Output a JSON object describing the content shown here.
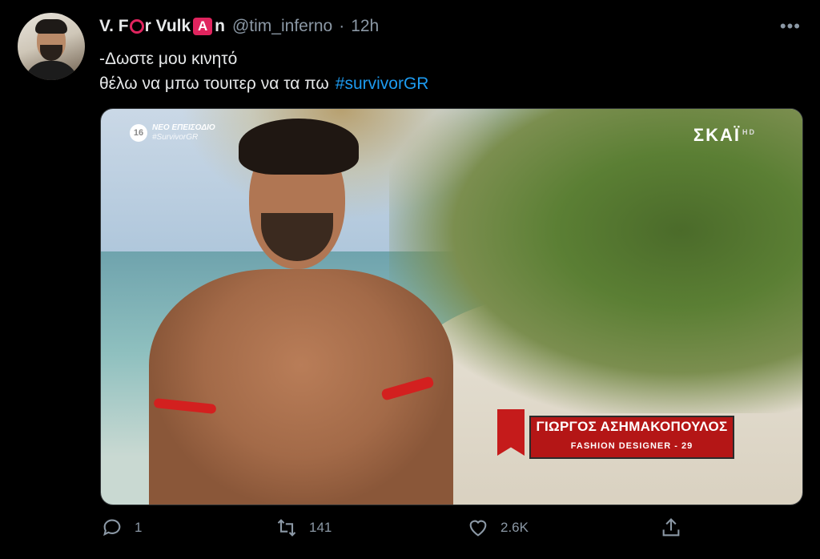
{
  "tweet": {
    "author": {
      "name_part1": "V. F",
      "name_part2": "r Vulk",
      "name_emoji_letter": "A",
      "name_part3": "n",
      "handle": "@tim_inferno",
      "separator": "·",
      "time": "12h"
    },
    "more_label": "•••",
    "text_line1": "-Δωστε μου κινητό",
    "text_line2": "θέλω να μπω τουιτερ να τα πω",
    "hashtag": "#survivorGR",
    "media": {
      "channel_number": "16",
      "badge_line1": "ΝΕΟ ΕΠΕΙΣΟΔΙΟ",
      "badge_line2": "#SurvivorGR",
      "network_logo": "ΣΚΑΪ",
      "network_logo_suffix": "HD",
      "caption_name": "ΓΙΩΡΓΟΣ ΑΣΗΜΑΚΟΠΟΥΛΟΣ",
      "caption_subtitle": "FASHION DESIGNER - 29"
    },
    "actions": {
      "reply_count": "1",
      "retweet_count": "141",
      "like_count": "2.6K"
    }
  },
  "colors": {
    "background": "#000000",
    "accent": "#1d9bf0",
    "muted": "#8b98a5",
    "emoji_red": "#e0245e"
  }
}
